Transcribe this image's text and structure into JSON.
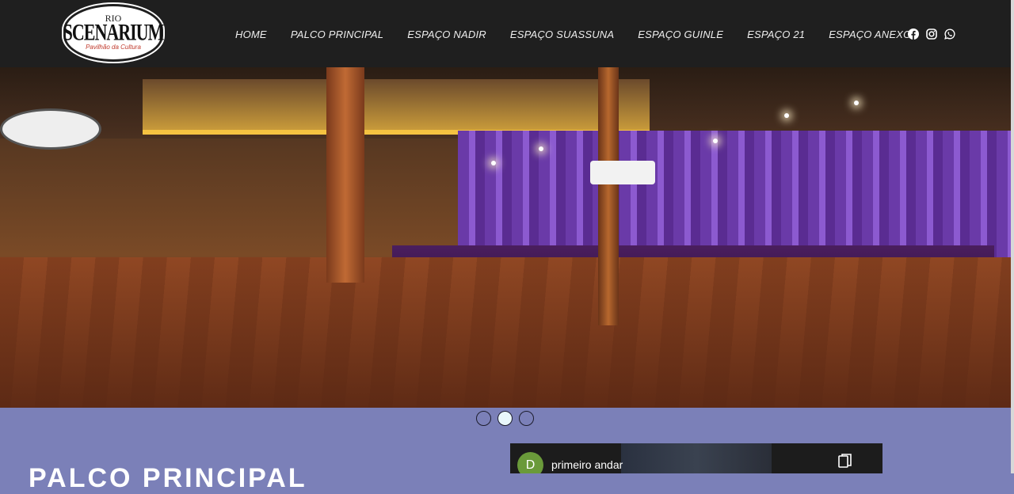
{
  "brand": {
    "top": "RIO",
    "name": "SCENARIUM",
    "tagline": "Pavilhão da Cultura"
  },
  "nav": {
    "items": [
      {
        "label": "HOME"
      },
      {
        "label": "PALCO PRINCIPAL"
      },
      {
        "label": "ESPAÇO NADIR"
      },
      {
        "label": "ESPAÇO SUASSUNA"
      },
      {
        "label": "ESPAÇO GUINLE"
      },
      {
        "label": "ESPAÇO 21"
      },
      {
        "label": "ESPAÇO ANEXO"
      }
    ]
  },
  "social": {
    "icons": [
      "facebook-icon",
      "instagram-icon",
      "whatsapp-icon"
    ]
  },
  "carousel": {
    "slide_count": 3,
    "active_index": 1
  },
  "section": {
    "title": "PALCO PRINCIPAL"
  },
  "video": {
    "avatar_letter": "D",
    "title": "primeiro andar"
  },
  "colors": {
    "header_bg": "#1f1f1f",
    "section_bg": "#7b80b8",
    "active_dot": "#e9f7fb"
  }
}
